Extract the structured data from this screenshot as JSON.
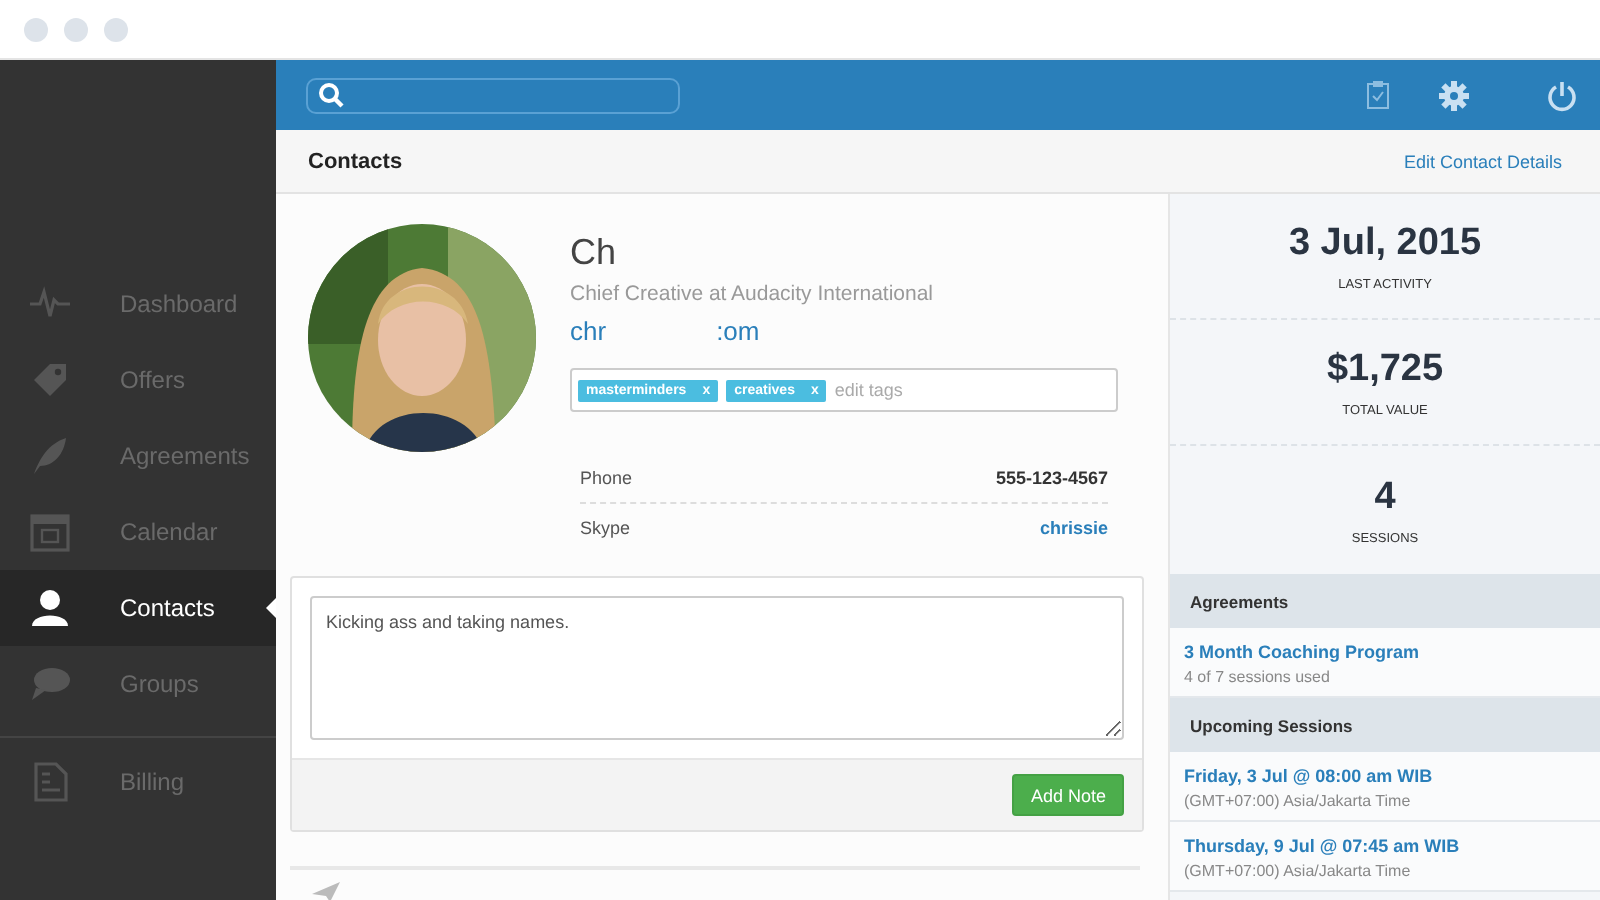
{
  "sidebar": {
    "items": [
      {
        "label": "Dashboard",
        "kind": "pulse",
        "selected": false,
        "separated": false
      },
      {
        "label": "Offers",
        "kind": "tag",
        "selected": false,
        "separated": false
      },
      {
        "label": "Agreements",
        "kind": "feather",
        "selected": false,
        "separated": false
      },
      {
        "label": "Calendar",
        "kind": "calendar",
        "selected": false,
        "separated": false
      },
      {
        "label": "Contacts",
        "kind": "person",
        "selected": true,
        "separated": false
      },
      {
        "label": "Groups",
        "kind": "chat",
        "selected": false,
        "separated": false
      },
      {
        "label": "Billing",
        "kind": "bill",
        "selected": false,
        "separated": true
      }
    ]
  },
  "header": {
    "title": "Contacts",
    "action": "Edit Contact Details"
  },
  "contact": {
    "name": "Ch",
    "role": "Chief Creative at Audacity International",
    "email_parts": [
      "chr",
      ":om"
    ],
    "tags": [
      {
        "label": "masterminders",
        "remove": "x"
      },
      {
        "label": "creatives",
        "remove": "x"
      }
    ],
    "tag_placeholder": "edit tags",
    "details": [
      {
        "label": "Phone",
        "value": "555-123-4567",
        "kind": "text"
      },
      {
        "label": "Skype",
        "value": "chrissie",
        "kind": "link"
      }
    ]
  },
  "note": {
    "value": "Kicking ass and taking names.",
    "button": "Add Note"
  },
  "stats": [
    {
      "value": "3 Jul, 2015",
      "label": "LAST ACTIVITY"
    },
    {
      "value": "$1,725",
      "label": "TOTAL VALUE"
    },
    {
      "value": "4",
      "label": "SESSIONS"
    }
  ],
  "agreements": {
    "title": "Agreements",
    "items": [
      {
        "title": "3 Month Coaching Program",
        "detail": "4 of 7 sessions used"
      }
    ]
  },
  "upcoming": {
    "title": "Upcoming Sessions",
    "items": [
      {
        "title": "Friday, 3 Jul @ 08:00 am WIB",
        "detail": "(GMT+07:00) Asia/Jakarta Time"
      },
      {
        "title": "Thursday, 9 Jul @ 07:45 am WIB",
        "detail": "(GMT+07:00) Asia/Jakarta Time"
      }
    ]
  }
}
